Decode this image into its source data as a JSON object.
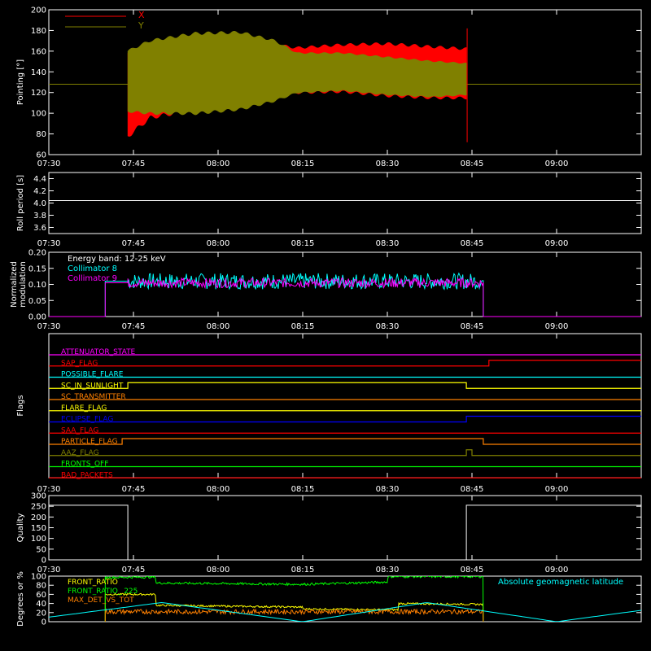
{
  "chart_data": [
    {
      "type": "line",
      "ylabel": "Pointing [°]",
      "ylim": [
        60,
        200
      ],
      "yticks": [
        "60",
        "80",
        "100",
        "120",
        "140",
        "160",
        "180",
        "200"
      ],
      "xlim": [
        "07:30",
        "09:15"
      ],
      "xticks": [
        "07:30",
        "07:45",
        "08:00",
        "08:15",
        "08:30",
        "08:45",
        "09:00"
      ],
      "legend_position": "top-left",
      "series": [
        {
          "name": "X",
          "color": "#ff0000",
          "envelope_x": [
            "07:44",
            "07:48",
            "07:56",
            "08:05",
            "08:14",
            "08:22",
            "08:30",
            "08:38",
            "08:44"
          ],
          "upper": [
            158,
            164,
            166,
            170,
            163,
            166,
            167,
            164,
            162
          ],
          "lower": [
            78,
            96,
            104,
            112,
            120,
            121,
            117,
            115,
            115
          ]
        },
        {
          "name": "Y",
          "color": "#808000",
          "envelope_x": [
            "07:44",
            "07:48",
            "07:56",
            "08:04",
            "08:10",
            "08:14",
            "08:22",
            "08:30",
            "08:38",
            "08:44"
          ],
          "upper": [
            160,
            170,
            177,
            178,
            170,
            158,
            158,
            154,
            150,
            148
          ],
          "lower": [
            102,
            100,
            100,
            104,
            112,
            120,
            122,
            118,
            116,
            118
          ]
        }
      ],
      "baseline": 128
    },
    {
      "type": "line",
      "ylabel": "Roll period [s]",
      "ylim": [
        3.5,
        4.5
      ],
      "yticks": [
        "3.6",
        "3.8",
        "4.0",
        "4.2",
        "4.4"
      ],
      "xticks": [
        "07:30",
        "07:45",
        "08:00",
        "08:15",
        "08:30",
        "08:45",
        "09:00"
      ],
      "series": [
        {
          "name": "",
          "color": "#ffffff",
          "x": [
            "07:30",
            "09:15"
          ],
          "values": [
            4.04,
            4.04
          ]
        }
      ]
    },
    {
      "type": "line",
      "ylabel": "Normalized modulation",
      "ylim": [
        0,
        0.2
      ],
      "yticks": [
        "0.00",
        "0.05",
        "0.10",
        "0.15",
        "0.20"
      ],
      "xticks": [
        "07:30",
        "07:45",
        "08:00",
        "08:15",
        "08:30",
        "08:45",
        "09:00"
      ],
      "annotation": "Energy band: 12-25 keV",
      "active_range": [
        "07:40",
        "08:47"
      ],
      "series": [
        {
          "name": "Collimator 8",
          "color": "#00ffff",
          "mean": 0.11,
          "spread": 0.025
        },
        {
          "name": "Collimator 9",
          "color": "#ff00ff",
          "mean": 0.105,
          "spread": 0.015
        }
      ]
    },
    {
      "type": "step",
      "ylabel": "Flags",
      "xticks": [
        "07:30",
        "07:45",
        "08:00",
        "08:15",
        "08:30",
        "08:45",
        "09:00"
      ],
      "flags": [
        {
          "name": "ATTENUATOR_STATE",
          "color": "#ff00ff",
          "changes": []
        },
        {
          "name": "SAP_FLAG",
          "color": "#ff0000",
          "changes": [
            {
              "t": "08:48",
              "level": 1
            }
          ]
        },
        {
          "name": "POSSIBLE_FLARE",
          "color": "#00ffff",
          "changes": []
        },
        {
          "name": "SC_IN_SUNLIGHT",
          "color": "#ffff00",
          "changes": [
            {
              "t": "07:44",
              "level": 1
            },
            {
              "t": "08:44",
              "level": 0
            }
          ]
        },
        {
          "name": "SC_TRANSMITTER",
          "color": "#ff8000",
          "changes": []
        },
        {
          "name": "FLARE_FLAG",
          "color": "#ffff00",
          "changes": []
        },
        {
          "name": "ECLIPSE_FLAG",
          "color": "#0000ff",
          "changes": [
            {
              "t": "07:44",
              "level": 0
            },
            {
              "t": "08:44",
              "level": 1
            }
          ]
        },
        {
          "name": "SAA_FLAG",
          "color": "#ff0000",
          "changes": []
        },
        {
          "name": "PARTICLE_FLAG",
          "color": "#ff8000",
          "changes": [
            {
              "t": "07:43",
              "level": 1
            },
            {
              "t": "07:44",
              "level": 1
            },
            {
              "t": "08:47",
              "level": 0
            }
          ]
        },
        {
          "name": "AAZ_FLAG",
          "color": "#808000",
          "changes": [
            {
              "t": "08:44",
              "level": 1
            },
            {
              "t": "08:45",
              "level": 0
            }
          ]
        },
        {
          "name": "FRONTS_OFF",
          "color": "#00ff00",
          "changes": []
        },
        {
          "name": "BAD_PACKETS",
          "color": "#ff0000",
          "changes": []
        }
      ]
    },
    {
      "type": "step",
      "ylabel": "Quality",
      "ylim": [
        0,
        300
      ],
      "yticks": [
        "0",
        "50",
        "100",
        "150",
        "200",
        "250",
        "300"
      ],
      "xticks": [
        "07:30",
        "07:45",
        "08:00",
        "08:15",
        "08:30",
        "08:45",
        "09:00"
      ],
      "series": [
        {
          "name": "",
          "color": "#ffffff",
          "x": [
            "07:30",
            "07:44",
            "07:44",
            "08:44",
            "08:44",
            "09:15"
          ],
          "values": [
            255,
            255,
            0,
            0,
            255,
            255
          ]
        }
      ]
    },
    {
      "type": "line",
      "ylabel": "Degrees or %",
      "ylim": [
        0,
        100
      ],
      "yticks": [
        "0",
        "20",
        "40",
        "60",
        "80",
        "100"
      ],
      "series": [
        {
          "name": "FRONT_RATIO",
          "color": "#ffff00",
          "x": [
            "07:40",
            "07:49",
            "07:49",
            "08:15",
            "08:15",
            "08:32",
            "08:32",
            "08:47"
          ],
          "values": [
            60,
            60,
            36,
            32,
            28,
            26,
            40,
            38
          ],
          "jitter": 2
        },
        {
          "name": "FRONT_RATIO_ 225",
          "color": "#00ff00",
          "x": [
            "07:40",
            "07:49",
            "07:49",
            "08:15",
            "08:30",
            "08:30",
            "08:47"
          ],
          "values": [
            97,
            98,
            85,
            82,
            87,
            99,
            99
          ],
          "jitter": 2.5
        },
        {
          "name": "MAX_DET_VS_TOT",
          "color": "#ff8000",
          "x": [
            "07:40",
            "08:47"
          ],
          "values": [
            22,
            22
          ],
          "jitter": 5
        },
        {
          "name": "Absolute geomagnetic latitude",
          "color": "#00ffff",
          "x": [
            "07:30",
            "07:50",
            "08:15",
            "08:37",
            "09:00",
            "09:15"
          ],
          "values": [
            10,
            42,
            0,
            42,
            0,
            25
          ]
        }
      ]
    }
  ]
}
